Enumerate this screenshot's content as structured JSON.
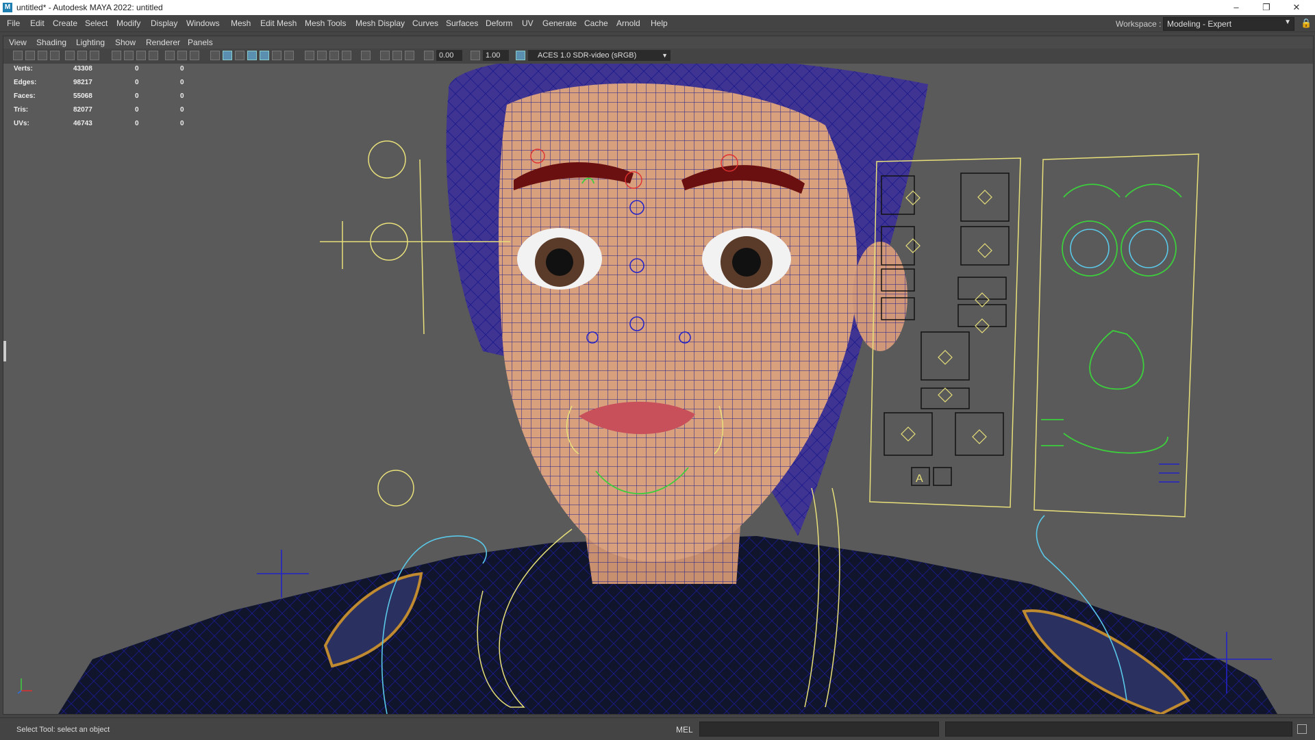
{
  "window": {
    "title": "untitled* - Autodesk MAYA 2022: untitled",
    "icon": "maya-app-icon",
    "icon_letter": "M",
    "controls": [
      "minimize-icon",
      "restore-icon",
      "close-icon"
    ]
  },
  "menubar": {
    "items": [
      "File",
      "Edit",
      "Create",
      "Select",
      "Modify",
      "Display",
      "Windows",
      "Mesh",
      "Edit Mesh",
      "Mesh Tools",
      "Mesh Display",
      "Curves",
      "Surfaces",
      "Deform",
      "UV",
      "Generate",
      "Cache",
      "Arnold",
      "Help"
    ],
    "workspace_label": "Workspace :",
    "workspace_value": "Modeling - Expert"
  },
  "panel": {
    "menus": [
      "View",
      "Shading",
      "Lighting",
      "Show",
      "Renderer",
      "Panels"
    ],
    "exposure": "0.00",
    "gamma": "1.00",
    "colorspace": "ACES 1.0 SDR-video (sRGB)"
  },
  "hud": [
    {
      "label": "Verts:",
      "a": "43308",
      "b": "0",
      "c": "0"
    },
    {
      "label": "Edges:",
      "a": "98217",
      "b": "0",
      "c": "0"
    },
    {
      "label": "Faces:",
      "a": "55068",
      "b": "0",
      "c": "0"
    },
    {
      "label": "Tris:",
      "a": "82077",
      "b": "0",
      "c": "0"
    },
    {
      "label": "UVs:",
      "a": "46743",
      "b": "0",
      "c": "0"
    }
  ],
  "viewport": {
    "camera": "persp",
    "rig_panel_glyph": "A"
  },
  "status": {
    "message": "Select Tool: select an object",
    "mel_label": "MEL"
  },
  "colors": {
    "background": "#444444",
    "viewport_bg": "#5a5a5a",
    "wireframe": "#1a1a8c",
    "rig_yellow": "#e8e07a",
    "rig_green": "#3ccf3c",
    "rig_cyan": "#5ac8e8",
    "skin": "#d8a07e",
    "hair": "#4a3fa0",
    "uniform": "#101428"
  }
}
